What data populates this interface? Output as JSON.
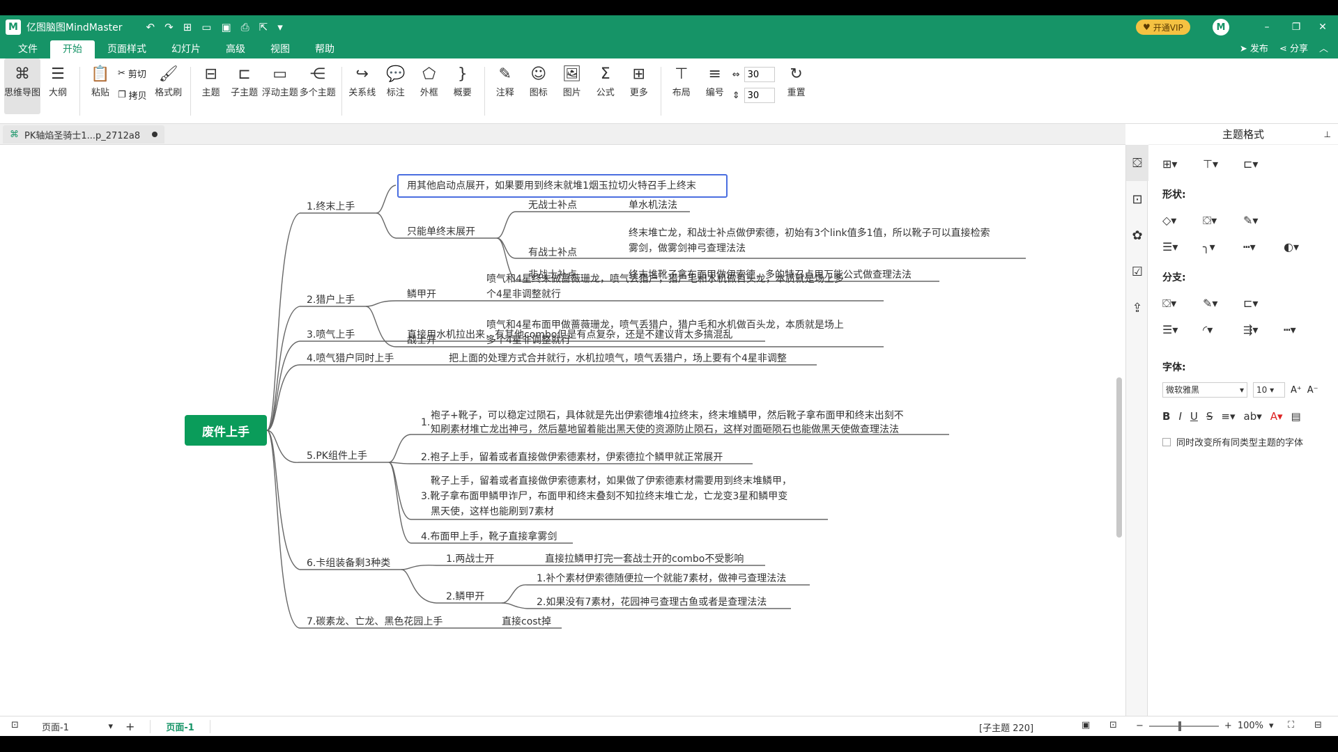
{
  "app": {
    "title": "亿图脑图MindMaster",
    "vip_label": "开通VIP",
    "avatar_letter": "M",
    "publish_label": "发布",
    "share_label": "分享"
  },
  "menu": [
    "文件",
    "开始",
    "页面样式",
    "幻灯片",
    "高级",
    "视图",
    "帮助"
  ],
  "ribbon": {
    "mindmap": "思维导图",
    "outline": "大纲",
    "paste": "粘贴",
    "cut": "剪切",
    "copy": "拷贝",
    "format_painter": "格式刷",
    "topic": "主题",
    "subtopic": "子主题",
    "floating_topic": "浮动主题",
    "multi_topic": "多个主题",
    "relation": "关系线",
    "callout": "标注",
    "boundary": "外框",
    "summary": "概要",
    "note": "注释",
    "icon": "图标",
    "image": "图片",
    "formula": "公式",
    "more": "更多",
    "layout": "布局",
    "numbering": "编号",
    "h_spacing": "30",
    "v_spacing": "30",
    "reset": "重置"
  },
  "doc_tab": "PK轴焰圣骑士1...p_2712a8",
  "mindmap": {
    "root": "废件上手",
    "selected_topic": "用其他启动点展开，如果要用到终末就堆1烟玉拉切火特召手上终末",
    "b1": "1.终末上手",
    "b1_only": "只能单终末展开",
    "b1_no_warrior": "无战士补点",
    "b1_no_warrior_d": "单水机法法",
    "b1_has_warrior": "有战士补点",
    "b1_has_warrior_d1": "终末堆亡龙，和战士补点做伊索德，初始有3个link值多1值，所以靴子可以直接检索",
    "b1_has_warrior_d2": "雾剑，做雾剑神弓查理法法",
    "b1_non_warrior": "非战士补点",
    "b1_non_warrior_d": "终末堆靴子拿布面甲做伊索德，多的特召点用万能公式做查理法法",
    "b2": "2.猎户上手",
    "b2_scale": "鳞甲开",
    "b2_scale_d1": "喷气和4星终末做蔷薇珊龙，喷气丢猎户，猎户毛和水机做百头龙，本质就是场上多",
    "b2_scale_d2": "个4星非调整就行",
    "b2_warrior": "战士开",
    "b2_warrior_d1": "喷气和4星布面甲做蔷薇珊龙，喷气丢猎户，猎户毛和水机做百头龙，本质就是场上",
    "b2_warrior_d2": "多个4星非调整就行",
    "b3": "3.喷气上手",
    "b3_d": "直接用水机拉出来，有其他combo但是有点复杂，还是不建议背太多搞混乱",
    "b4": "4.喷气猎户同时上手",
    "b4_d": "把上面的处理方式合并就行，水机拉喷气，喷气丢猎户，场上要有个4星非调整",
    "b5": "5.PK组件上手",
    "b5_1_num": "1.",
    "b5_1_l1": "袍子+靴子，可以稳定过陨石，具体就是先出伊索德堆4拉终末，终末堆鳞甲，然后靴子拿布面甲和终末出刻不",
    "b5_1_l2": "知刷素材堆亡龙出神弓，然后墓地留着能出黑天使的资源防止陨石，这样对面砸陨石也能做黑天使做查理法法",
    "b5_2": "2.袍子上手，留着或者直接做伊索德素材，伊索德拉个鳞甲就正常展开",
    "b5_3_l1": "靴子上手，留着或者直接做伊索德素材，如果做了伊索德素材需要用到终末堆鳞甲，",
    "b5_3_l2": "3.靴子拿布面甲鳞甲诈尸，布面甲和终末叠刻不知拉终末堆亡龙，亡龙变3星和鳞甲变",
    "b5_3_l3": "黑天使，这样也能刷到7素材",
    "b5_4": "4.布面甲上手，靴子直接拿雾剑",
    "b6": "6.卡组装备剩3种类",
    "b6_1": "1.两战士开",
    "b6_1_d": "直接拉鳞甲打完一套战士开的combo不受影响",
    "b6_2": "2.鳞甲开",
    "b6_2_d1": "1.补个素材伊索德随便拉一个就能7素材，做神弓查理法法",
    "b6_2_d2": "2.如果没有7素材，花园神弓查理古鱼或者是查理法法",
    "b7": "7.碳素龙、亡龙、黑色花园上手",
    "b7_d": "直接cost掉"
  },
  "panel": {
    "title": "主题格式",
    "shape": "形状:",
    "branch": "分支:",
    "font": "字体:",
    "font_name": "微软雅黑",
    "font_size": "10",
    "same_type": "同时改变所有同类型主题的字体"
  },
  "status": {
    "page_select": "页面-1",
    "page_tab": "页面-1",
    "info": "[子主题 220]",
    "zoom": "100%"
  },
  "colors": {
    "brand": "#169467",
    "root": "#0a9c5a",
    "selection": "#4a6ee0"
  }
}
